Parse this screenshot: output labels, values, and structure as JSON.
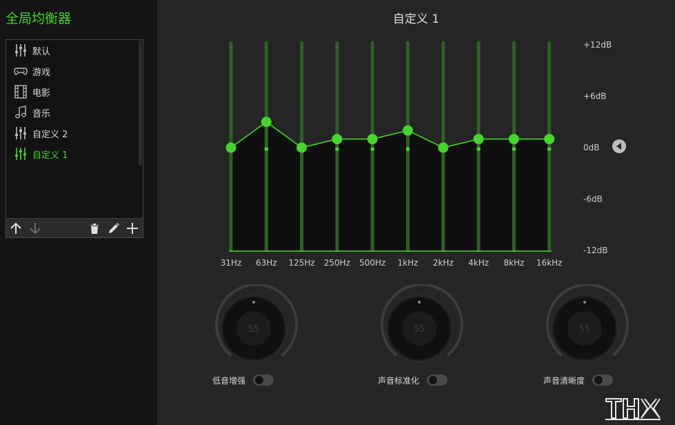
{
  "app": {
    "title": "全局均衡器"
  },
  "presets": {
    "items": [
      {
        "label": "默认",
        "icon": "sliders-icon"
      },
      {
        "label": "游戏",
        "icon": "gamepad-icon"
      },
      {
        "label": "电影",
        "icon": "film-icon"
      },
      {
        "label": "音乐",
        "icon": "music-note-icon"
      },
      {
        "label": "自定义 2",
        "icon": "sliders-icon"
      },
      {
        "label": "自定义 1",
        "icon": "sliders-icon",
        "active": true
      }
    ],
    "toolbar": [
      "arrow-up-icon",
      "arrow-down-icon",
      "trash-icon",
      "pencil-icon",
      "plus-icon"
    ]
  },
  "eq": {
    "title": "自定义 1",
    "db_labels": [
      "+12dB",
      "+6dB",
      "0dB",
      "-6dB",
      "-12dB"
    ],
    "db_range": [
      -12,
      12
    ],
    "bands": [
      {
        "freq": "31Hz",
        "gain": 0
      },
      {
        "freq": "63Hz",
        "gain": 3
      },
      {
        "freq": "125Hz",
        "gain": 0
      },
      {
        "freq": "250Hz",
        "gain": 1
      },
      {
        "freq": "500Hz",
        "gain": 1
      },
      {
        "freq": "1kHz",
        "gain": 2
      },
      {
        "freq": "2kHz",
        "gain": 0
      },
      {
        "freq": "4kHz",
        "gain": 1
      },
      {
        "freq": "8kHz",
        "gain": 1
      },
      {
        "freq": "16kHz",
        "gain": 1
      }
    ]
  },
  "knobs": [
    {
      "label": "低音增强",
      "value": "55",
      "enabled": false
    },
    {
      "label": "声音标准化",
      "value": "55",
      "enabled": false
    },
    {
      "label": "声音清晰度",
      "value": "55",
      "enabled": false
    }
  ],
  "colors": {
    "accent": "#44d62c",
    "panel": "#252525",
    "sidebar": "#141414"
  },
  "brand": {
    "logo": "THX"
  }
}
